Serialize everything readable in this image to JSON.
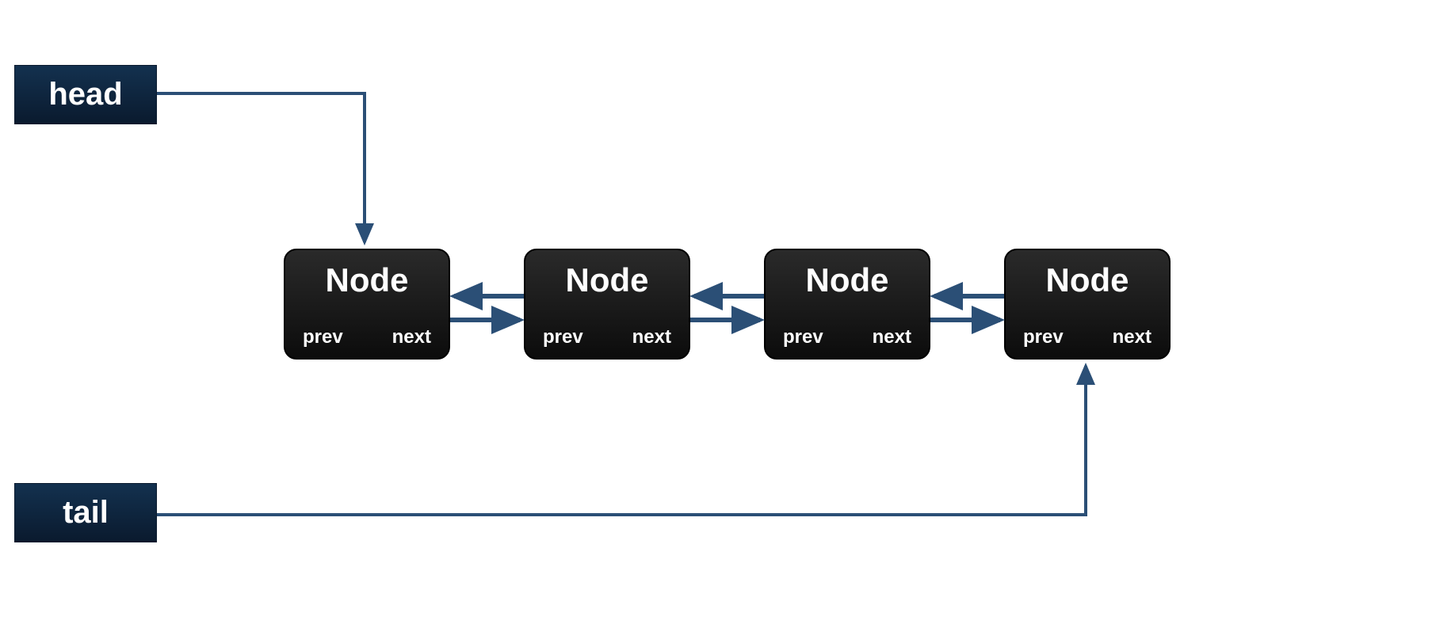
{
  "pointers": {
    "head": "head",
    "tail": "tail"
  },
  "node_labels": {
    "title": "Node",
    "prev": "prev",
    "next": "next"
  },
  "nodes": [
    {
      "title": "Node",
      "prev": "prev",
      "next": "next"
    },
    {
      "title": "Node",
      "prev": "prev",
      "next": "next"
    },
    {
      "title": "Node",
      "prev": "prev",
      "next": "next"
    },
    {
      "title": "Node",
      "prev": "prev",
      "next": "next"
    }
  ],
  "colors": {
    "arrow": "#2b4f76",
    "pointer_bg": "#0e2540",
    "node_bg": "#111111"
  }
}
